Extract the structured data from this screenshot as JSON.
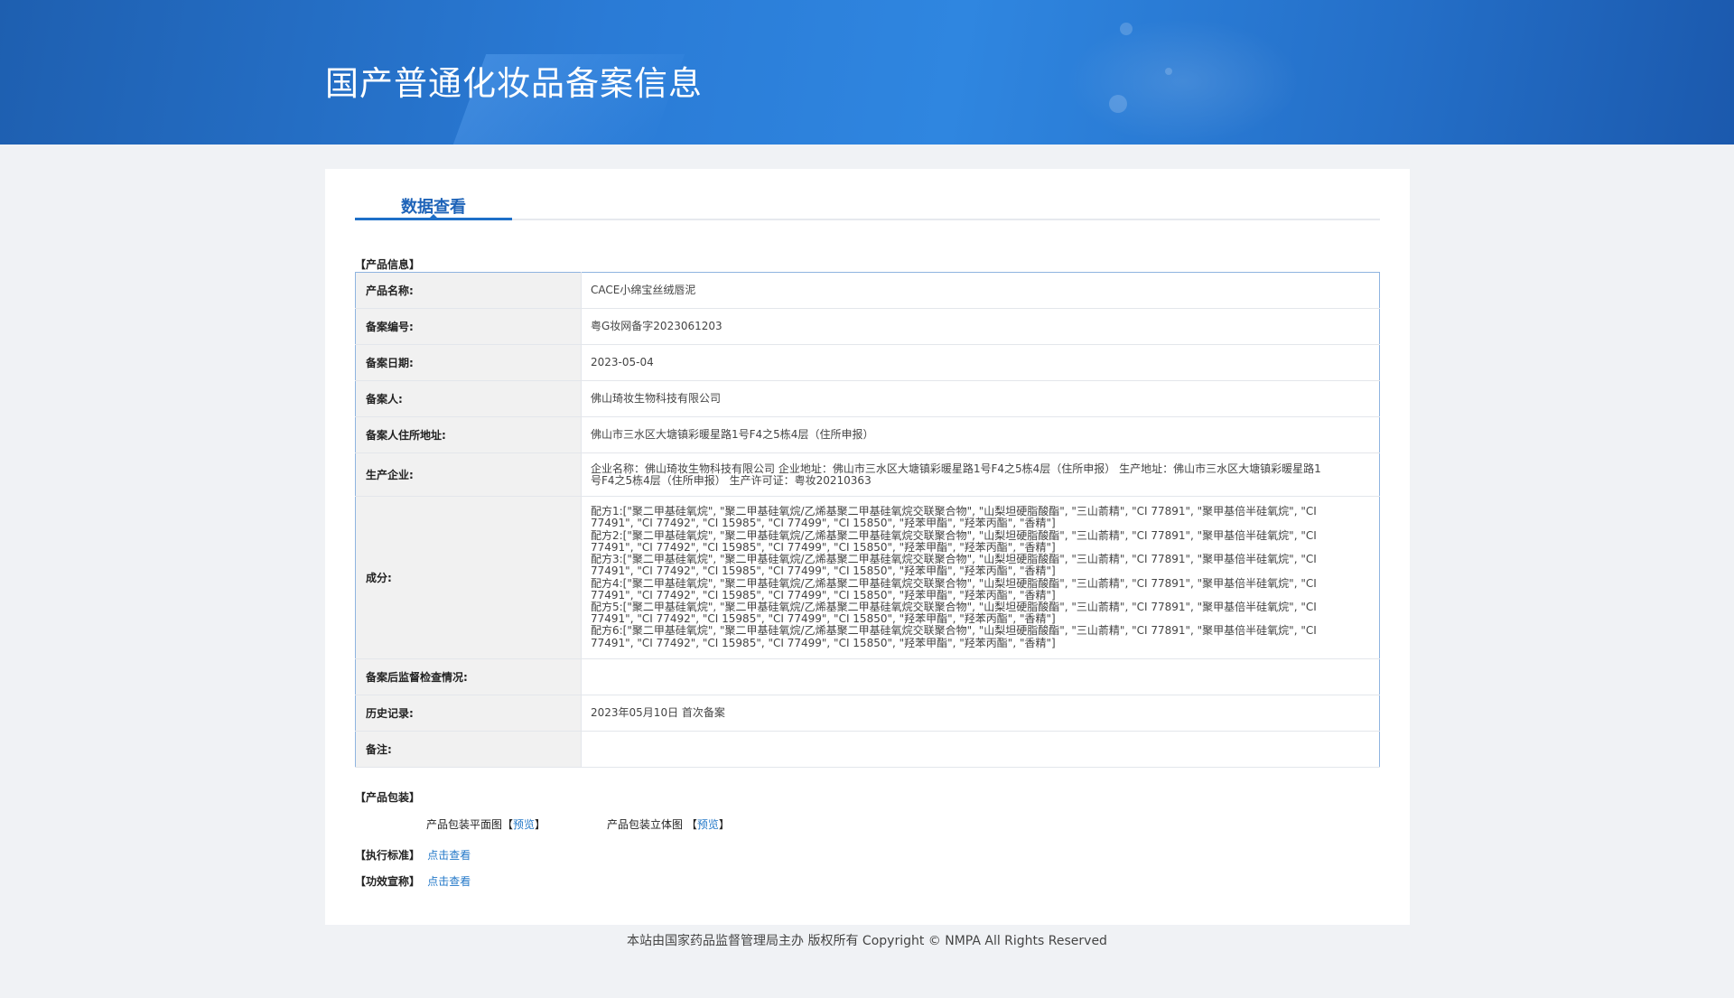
{
  "header": {
    "title": "国产普通化妆品备案信息"
  },
  "tabs": [
    {
      "label": "数据查看"
    }
  ],
  "product_info": {
    "section_label": "【产品信息】",
    "rows": [
      {
        "key": "产品名称:",
        "value": "CACE小绵宝丝绒唇泥"
      },
      {
        "key": "备案编号:",
        "value": "粤G妆网备字2023061203"
      },
      {
        "key": "备案日期:",
        "value": "2023-05-04"
      },
      {
        "key": "备案人:",
        "value": "佛山琦妆生物科技有限公司"
      },
      {
        "key": "备案人住所地址:",
        "value": "佛山市三水区大塘镇彩暖星路1号F4之5栋4层（住所申报）"
      },
      {
        "key": "生产企业:",
        "value": "企业名称：佛山琦妆生物科技有限公司 企业地址：佛山市三水区大塘镇彩暖星路1号F4之5栋4层（住所申报） 生产地址：佛山市三水区大塘镇彩暖星路1号F4之5栋4层（住所申报） 生产许可证：粤妆20210363"
      },
      {
        "key": "成分:",
        "value_lines": [
          "配方1:[\"聚二甲基硅氧烷\", \"聚二甲基硅氧烷/乙烯基聚二甲基硅氧烷交联聚合物\", \"山梨坦硬脂酸酯\", \"三山萮精\", \"CI 77891\", \"聚甲基倍半硅氧烷\", \"CI 77491\", \"CI 77492\", \"CI 15985\", \"CI 77499\", \"CI 15850\", \"羟苯甲酯\", \"羟苯丙酯\", \"香精\"]",
          "配方2:[\"聚二甲基硅氧烷\", \"聚二甲基硅氧烷/乙烯基聚二甲基硅氧烷交联聚合物\", \"山梨坦硬脂酸酯\", \"三山萮精\", \"CI 77891\", \"聚甲基倍半硅氧烷\", \"CI 77491\", \"CI 77492\", \"CI 15985\", \"CI 77499\", \"CI 15850\", \"羟苯甲酯\", \"羟苯丙酯\", \"香精\"]",
          "配方3:[\"聚二甲基硅氧烷\", \"聚二甲基硅氧烷/乙烯基聚二甲基硅氧烷交联聚合物\", \"山梨坦硬脂酸酯\", \"三山萮精\", \"CI 77891\", \"聚甲基倍半硅氧烷\", \"CI 77491\", \"CI 77492\", \"CI 15985\", \"CI 77499\", \"CI 15850\", \"羟苯甲酯\", \"羟苯丙酯\", \"香精\"]",
          "配方4:[\"聚二甲基硅氧烷\", \"聚二甲基硅氧烷/乙烯基聚二甲基硅氧烷交联聚合物\", \"山梨坦硬脂酸酯\", \"三山萮精\", \"CI 77891\", \"聚甲基倍半硅氧烷\", \"CI 77491\", \"CI 77492\", \"CI 15985\", \"CI 77499\", \"CI 15850\", \"羟苯甲酯\", \"羟苯丙酯\", \"香精\"]",
          "配方5:[\"聚二甲基硅氧烷\", \"聚二甲基硅氧烷/乙烯基聚二甲基硅氧烷交联聚合物\", \"山梨坦硬脂酸酯\", \"三山萮精\", \"CI 77891\", \"聚甲基倍半硅氧烷\", \"CI 77491\", \"CI 77492\", \"CI 15985\", \"CI 77499\", \"CI 15850\", \"羟苯甲酯\", \"羟苯丙酯\", \"香精\"]",
          "配方6:[\"聚二甲基硅氧烷\", \"聚二甲基硅氧烷/乙烯基聚二甲基硅氧烷交联聚合物\", \"山梨坦硬脂酸酯\", \"三山萮精\", \"CI 77891\", \"聚甲基倍半硅氧烷\", \"CI 77491\", \"CI 77492\", \"CI 15985\", \"CI 77499\", \"CI 15850\", \"羟苯甲酯\", \"羟苯丙酯\", \"香精\"]"
        ]
      },
      {
        "key": "备案后监督检查情况:",
        "value": ""
      },
      {
        "key": "历史记录:",
        "value": "2023年05月10日 首次备案"
      },
      {
        "key": "备注:",
        "value": ""
      }
    ]
  },
  "packaging": {
    "section_label": "【产品包装】",
    "flat_label": "产品包装平面图",
    "solid_label": "产品包装立体图",
    "bracket_open": "【",
    "bracket_close": "】",
    "preview_link": "预览"
  },
  "standard": {
    "label": "【执行标准】",
    "link": "点击查看"
  },
  "efficacy": {
    "label": "【功效宣称】",
    "link": "点击查看"
  },
  "footer": {
    "text": "本站由国家药品监督管理局主办 版权所有 Copyright © NMPA All Rights Reserved"
  }
}
